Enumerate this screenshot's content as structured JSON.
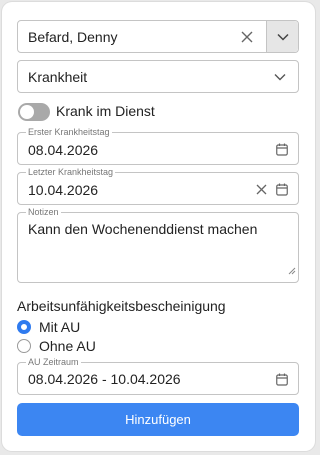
{
  "employee_select": {
    "value": "Befard, Denny",
    "icons": [
      "close-icon",
      "chevron-down-icon"
    ]
  },
  "reason_select": {
    "value": "Krankheit",
    "icon": "chevron-down-icon"
  },
  "sick_on_duty": {
    "label": "Krank im Dienst",
    "checked": false
  },
  "first_sick_day": {
    "legend": "Erster Krankheitstag",
    "value": "08.04.2026",
    "icon": "calendar-icon"
  },
  "last_sick_day": {
    "legend": "Letzter Krankheitstag",
    "value": "10.04.2026",
    "icons": [
      "close-icon",
      "calendar-icon"
    ]
  },
  "notes": {
    "legend": "Notizen",
    "value": "Kann den Wochenenddienst machen"
  },
  "certificate": {
    "heading": "Arbeitsunfähigkeitsbescheinigung",
    "options": [
      {
        "label": "Mit AU",
        "checked": true
      },
      {
        "label": "Ohne AU",
        "checked": false
      }
    ]
  },
  "au_period": {
    "legend": "AU Zeitraum",
    "value": "08.04.2026 - 10.04.2026",
    "icon": "calendar-icon"
  },
  "submit": {
    "label": "Hinzufügen"
  },
  "colors": {
    "accent": "#3c86f2",
    "radio": "#2f7bef",
    "toggle_off": "#a9a9a9"
  }
}
